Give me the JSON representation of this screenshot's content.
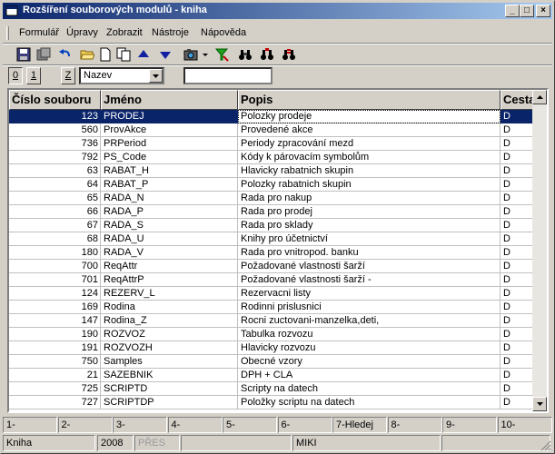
{
  "window": {
    "title": "Rozšíření souborových modulů - kniha",
    "controls": {
      "minimize": "_",
      "maximize": "□",
      "close": "×"
    }
  },
  "menu": [
    "Formulář",
    "Úpravy",
    "Zobrazit",
    "Nástroje",
    "Nápověda"
  ],
  "toolbar": {
    "icons": [
      "save-icon",
      "save-all-icon",
      "undo-icon",
      "open-folder-icon",
      "new-document-icon",
      "copy-icon",
      "arrow-up-icon",
      "arrow-down-icon",
      "camera-icon",
      "dropdown-arrow-icon",
      "filter-icon",
      "binoculars-icon",
      "binoculars-next-icon",
      "binoculars-all-icon"
    ]
  },
  "filter": {
    "buttons": [
      "0",
      "1",
      "Z"
    ],
    "combo_value": "Nazev",
    "text_value": ""
  },
  "grid": {
    "columns": [
      "Číslo souboru",
      "Jméno",
      "Popis",
      "Cesta"
    ],
    "selected_index": 0,
    "rows": [
      [
        "123",
        "PRODEJ",
        "Polozky prodeje",
        "D"
      ],
      [
        "560",
        "ProvAkce",
        "Provedené akce",
        "D"
      ],
      [
        "736",
        "PRPeriod",
        "Periody zpracování mezd",
        "D"
      ],
      [
        "792",
        "PS_Code",
        "Kódy k párovacím symbolům",
        "D"
      ],
      [
        "63",
        "RABAT_H",
        "Hlavicky rabatnich skupin",
        "D"
      ],
      [
        "64",
        "RABAT_P",
        "Polozky rabatnich skupin",
        "D"
      ],
      [
        "65",
        "RADA_N",
        "Rada pro nakup",
        "D"
      ],
      [
        "66",
        "RADA_P",
        "Rada pro prodej",
        "D"
      ],
      [
        "67",
        "RADA_S",
        "Rada pro sklady",
        "D"
      ],
      [
        "68",
        "RADA_U",
        "Knihy pro účetnictví",
        "D"
      ],
      [
        "180",
        "RADA_V",
        "Rada pro vnitropod. banku",
        "D"
      ],
      [
        "700",
        "ReqAttr",
        "Požadované vlastnosti šarží",
        "D"
      ],
      [
        "701",
        "ReqAttrP",
        "Požadované vlastnosti šarží -",
        "D"
      ],
      [
        "124",
        "REZERV_L",
        "Rezervacni listy",
        "D"
      ],
      [
        "169",
        "Rodina",
        "Rodinni prislusnici",
        "D"
      ],
      [
        "147",
        "Rodina_Z",
        "Rocni zuctovani-manzelka,deti,",
        "D"
      ],
      [
        "190",
        "ROZVOZ",
        "Tabulka rozvozu",
        "D"
      ],
      [
        "191",
        "ROZVOZH",
        "Hlavicky rozvozu",
        "D"
      ],
      [
        "750",
        "Samples",
        "Obecné vzory",
        "D"
      ],
      [
        "21",
        "SAZEBNIK",
        "DPH + CLA",
        "D"
      ],
      [
        "725",
        "SCRIPTD",
        "Scripty na datech",
        "D"
      ],
      [
        "727",
        "SCRIPTDP",
        "Položky scriptu na datech",
        "D"
      ]
    ]
  },
  "fkeys": [
    "1-",
    "2-",
    "3-",
    "4-",
    "5-",
    "6-",
    "7-Hledej",
    "8-",
    "9-",
    "10-"
  ],
  "status": [
    "Kniha",
    "2008",
    "PŘES",
    "",
    "MIKI",
    ""
  ]
}
